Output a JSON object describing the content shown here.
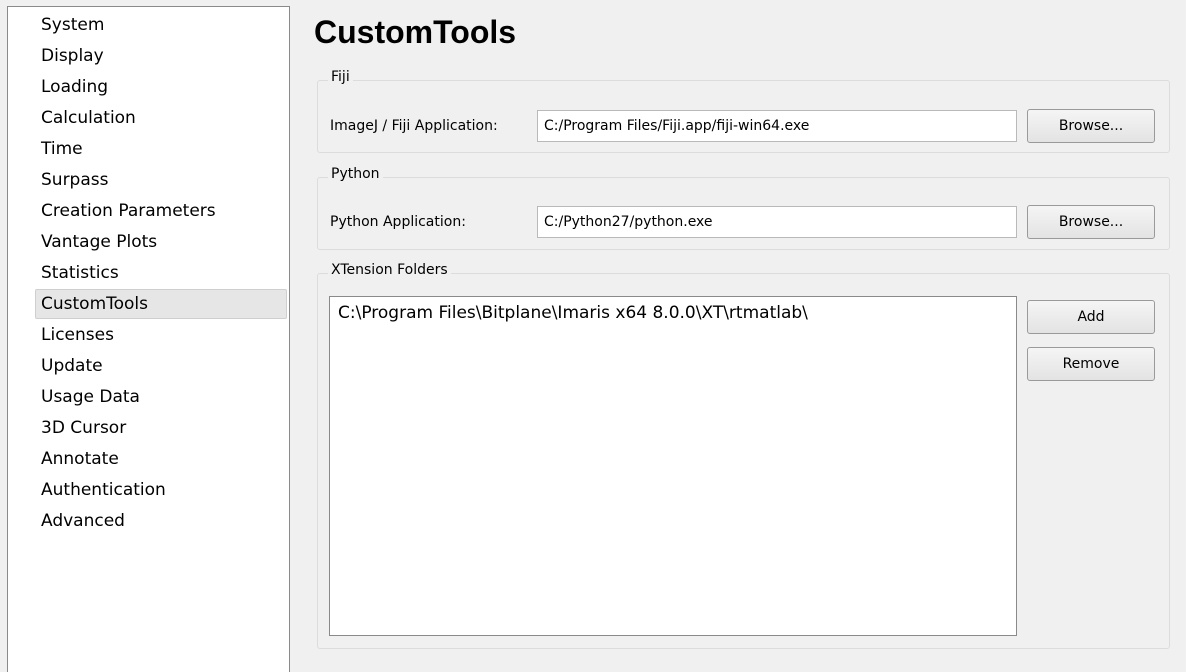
{
  "sidebar": {
    "items": [
      {
        "label": "System"
      },
      {
        "label": "Display"
      },
      {
        "label": "Loading"
      },
      {
        "label": "Calculation"
      },
      {
        "label": "Time"
      },
      {
        "label": "Surpass"
      },
      {
        "label": "Creation Parameters"
      },
      {
        "label": "Vantage Plots"
      },
      {
        "label": "Statistics"
      },
      {
        "label": "CustomTools",
        "selected": true
      },
      {
        "label": "Licenses"
      },
      {
        "label": "Update"
      },
      {
        "label": "Usage Data"
      },
      {
        "label": "3D Cursor"
      },
      {
        "label": "Annotate"
      },
      {
        "label": "Authentication"
      },
      {
        "label": "Advanced"
      }
    ]
  },
  "page": {
    "title": "CustomTools"
  },
  "fiji": {
    "group_title": "Fiji",
    "label": "ImageJ / Fiji Application:",
    "value": "C:/Program Files/Fiji.app/fiji-win64.exe",
    "browse_label": "Browse..."
  },
  "python": {
    "group_title": "Python",
    "label": "Python Application:",
    "value": "C:/Python27/python.exe",
    "browse_label": "Browse..."
  },
  "xtension": {
    "group_title": "XTension Folders",
    "folders": [
      "C:\\Program Files\\Bitplane\\Imaris x64 8.0.0\\XT\\rtmatlab\\"
    ],
    "add_label": "Add",
    "remove_label": "Remove"
  }
}
